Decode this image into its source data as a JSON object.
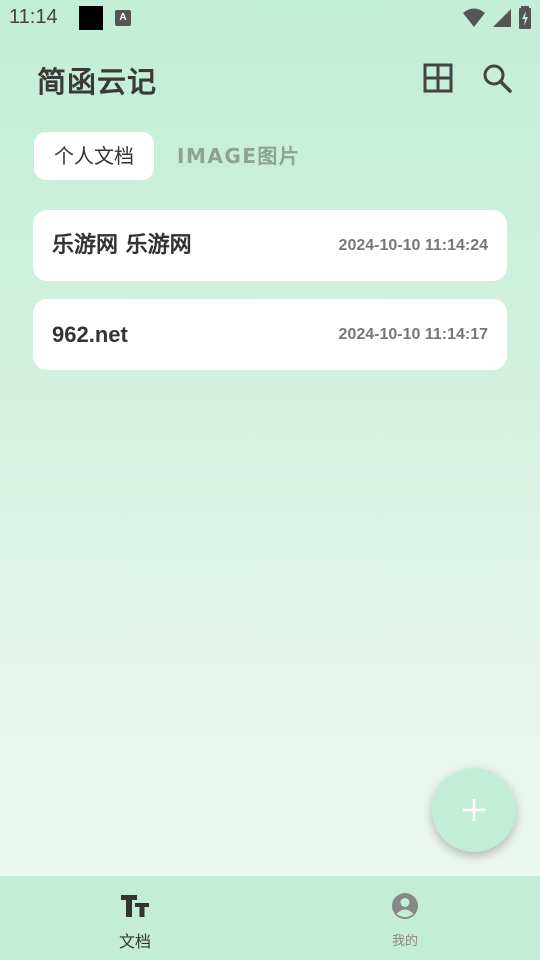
{
  "status_bar": {
    "time": "11:14",
    "notif_letter": "A"
  },
  "header": {
    "title": "简函云记"
  },
  "tabs": [
    {
      "label": "个人文档",
      "selected": true
    },
    {
      "label": "IMAGE图片",
      "selected": false
    }
  ],
  "documents": [
    {
      "title": "乐游网 乐游网",
      "timestamp": "2024-10-10 11:14:24"
    },
    {
      "title": "962.net",
      "timestamp": "2024-10-10 11:14:17"
    }
  ],
  "fab": {
    "icon": "plus-icon"
  },
  "bottom_nav": [
    {
      "label": "文档",
      "icon": "text-format-icon",
      "active": true
    },
    {
      "label": "我的",
      "icon": "account-circle-icon",
      "active": false
    }
  ],
  "colors": {
    "accent": "#c4edd9",
    "card": "#ffffff",
    "text": "#333333"
  }
}
